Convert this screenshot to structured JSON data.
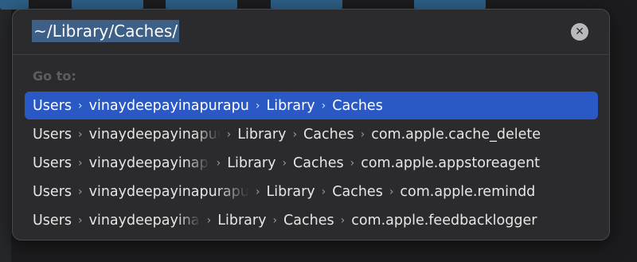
{
  "path_field": {
    "value": "~/Library/Caches/"
  },
  "goto_label": "Go to:",
  "rows": [
    {
      "segments": [
        "Users",
        "vinaydeepayinapurapu",
        "Library",
        "Caches"
      ],
      "selected": true
    },
    {
      "segments": [
        "Users",
        "vinaydeepayinapurapu",
        "Library",
        "Caches",
        "com.apple.cache_delete"
      ],
      "selected": false
    },
    {
      "segments": [
        "Users",
        "vinaydeepayinapurapu",
        "Library",
        "Caches",
        "com.apple.appstoreagent"
      ],
      "selected": false
    },
    {
      "segments": [
        "Users",
        "vinaydeepayinapurapu",
        "Library",
        "Caches",
        "com.apple.remindd"
      ],
      "selected": false
    },
    {
      "segments": [
        "Users",
        "vinaydeepayinapurapu",
        "Library",
        "Caches",
        "com.apple.feedbacklogger"
      ],
      "selected": false
    }
  ],
  "icons": {
    "clear": "clear-circle-icon",
    "separator": "chevron-right-icon"
  },
  "colors": {
    "selection": "#2a59c6",
    "text_selection": "#3e5f86",
    "panel": "#2b2b2d"
  }
}
